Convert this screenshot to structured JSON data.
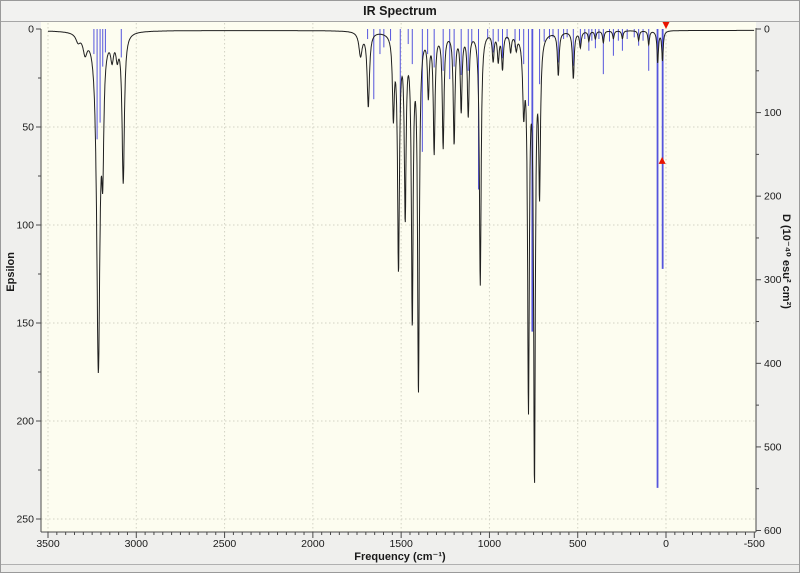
{
  "chart_data": {
    "type": "line+stick",
    "title": "IR Spectrum",
    "xlabel": "Frequency (cm⁻¹)",
    "ylabel_left": "Epsilon",
    "ylabel_right": "D (10⁻⁴⁰ esu² cm²)",
    "x_axis": {
      "start": 3500,
      "end": -500,
      "major": 500,
      "minor": 50,
      "reversed": true,
      "tick_labels": [
        "3500",
        "3000",
        "2500",
        "2000",
        "1500",
        "1000",
        "500",
        "0",
        "-500"
      ]
    },
    "y_axis_left": {
      "start": 0,
      "end": 250,
      "major": 50,
      "minor": 25,
      "inverted": true,
      "tick_labels": [
        "0",
        "50",
        "100",
        "150",
        "200",
        "250"
      ]
    },
    "y_axis_right": {
      "start": 0,
      "end": 600,
      "major": 100,
      "minor": 50,
      "inverted": true,
      "tick_labels": [
        "0",
        "100",
        "200",
        "300",
        "400",
        "500",
        "600"
      ]
    },
    "grid": {
      "style": "dotted",
      "vertical_at": [
        3500,
        3000,
        2500,
        2000,
        1500,
        1000,
        500,
        0
      ],
      "horizontal_at_epsilon": [
        50,
        100,
        150,
        200,
        250
      ]
    },
    "lorentzian_baseline": 0.7,
    "epsilon_peaks": [
      [
        3330,
        4,
        30
      ],
      [
        3290,
        9,
        28
      ],
      [
        3215,
        170,
        22
      ],
      [
        3190,
        54,
        14
      ],
      [
        3137,
        11,
        20
      ],
      [
        3108,
        10,
        18
      ],
      [
        3074,
        76,
        16
      ],
      [
        1730,
        12,
        22
      ],
      [
        1686,
        38,
        16
      ],
      [
        1544,
        40,
        13
      ],
      [
        1515,
        118,
        13
      ],
      [
        1477,
        90,
        12
      ],
      [
        1437,
        143,
        12
      ],
      [
        1402,
        180,
        12
      ],
      [
        1346,
        30,
        12
      ],
      [
        1313,
        60,
        12
      ],
      [
        1262,
        58,
        12
      ],
      [
        1200,
        56,
        12
      ],
      [
        1160,
        39,
        12
      ],
      [
        1120,
        42,
        12
      ],
      [
        1052,
        129,
        12
      ],
      [
        979,
        14,
        12
      ],
      [
        950,
        14,
        12
      ],
      [
        926,
        18,
        12
      ],
      [
        880,
        9,
        12
      ],
      [
        848,
        7,
        12
      ],
      [
        806,
        35,
        14
      ],
      [
        779,
        186,
        12
      ],
      [
        745,
        223,
        12
      ],
      [
        716,
        76,
        12
      ],
      [
        610,
        22,
        12
      ],
      [
        525,
        24,
        12
      ],
      [
        485,
        8,
        12
      ],
      [
        437,
        5,
        10
      ],
      [
        400,
        4,
        10
      ],
      [
        355,
        6,
        10
      ],
      [
        298,
        4,
        10
      ],
      [
        247,
        4,
        10
      ],
      [
        155,
        5,
        10
      ],
      [
        98,
        7,
        10
      ],
      [
        47,
        16,
        10
      ],
      [
        20,
        15,
        10
      ]
    ],
    "d_sticks": [
      [
        3240,
        30
      ],
      [
        3222,
        132
      ],
      [
        3205,
        112
      ],
      [
        3190,
        45
      ],
      [
        3175,
        28
      ],
      [
        3085,
        34
      ],
      [
        1690,
        12
      ],
      [
        1655,
        84
      ],
      [
        1620,
        30
      ],
      [
        1598,
        22
      ],
      [
        1560,
        14
      ],
      [
        1505,
        100
      ],
      [
        1460,
        18
      ],
      [
        1437,
        42
      ],
      [
        1380,
        147
      ],
      [
        1350,
        30
      ],
      [
        1313,
        46
      ],
      [
        1262,
        50
      ],
      [
        1225,
        60
      ],
      [
        1200,
        45
      ],
      [
        1160,
        55
      ],
      [
        1120,
        50
      ],
      [
        1100,
        18
      ],
      [
        1062,
        192
      ],
      [
        1010,
        12
      ],
      [
        979,
        28
      ],
      [
        950,
        15
      ],
      [
        926,
        35
      ],
      [
        900,
        12
      ],
      [
        855,
        22
      ],
      [
        830,
        14
      ],
      [
        806,
        42
      ],
      [
        779,
        92
      ],
      [
        757,
        362
      ],
      [
        716,
        66
      ],
      [
        690,
        15
      ],
      [
        660,
        12
      ],
      [
        640,
        10
      ],
      [
        610,
        40
      ],
      [
        580,
        12
      ],
      [
        560,
        10
      ],
      [
        525,
        44
      ],
      [
        485,
        20
      ],
      [
        460,
        12
      ],
      [
        437,
        26
      ],
      [
        420,
        14
      ],
      [
        400,
        23
      ],
      [
        380,
        12
      ],
      [
        355,
        54
      ],
      [
        320,
        15
      ],
      [
        298,
        32
      ],
      [
        270,
        14
      ],
      [
        247,
        26
      ],
      [
        220,
        12
      ],
      [
        180,
        10
      ],
      [
        155,
        20
      ],
      [
        130,
        14
      ],
      [
        98,
        50
      ],
      [
        48,
        549
      ],
      [
        19,
        287
      ]
    ],
    "markers": [
      {
        "freq": 0,
        "d_value": 0,
        "direction": "down"
      },
      {
        "freq": 22,
        "d_value": 153,
        "direction": "up"
      }
    ],
    "colors": {
      "curve": "#202020",
      "sticks": "#5555dd",
      "plot_bg": "#fdfdf0",
      "grid": "#d2d2c4",
      "axis": "#4a4a4a",
      "marker": "#e81400",
      "window_bg": "#efefed"
    }
  }
}
